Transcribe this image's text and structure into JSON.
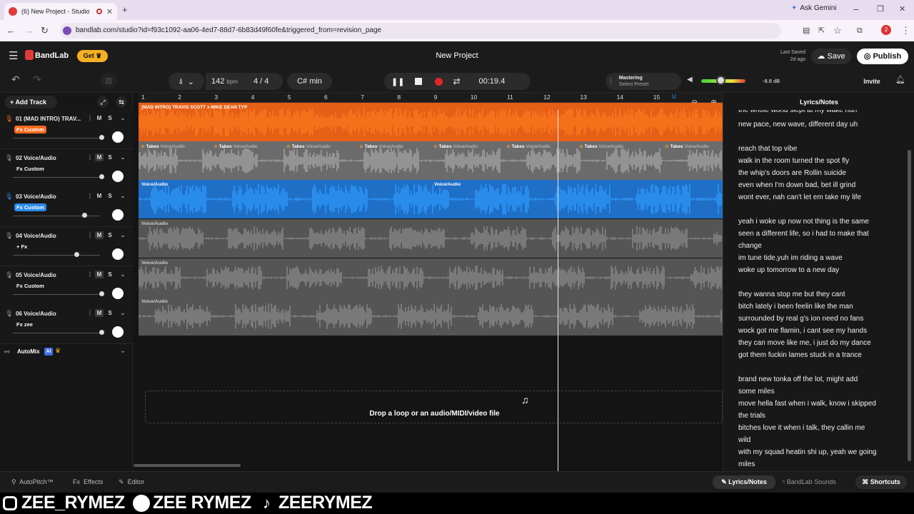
{
  "browser": {
    "tab_title": "(6) New Project - Studio",
    "url": "bandlab.com/studio?id=f93c1092-aa06-4ed7-88d7-6b83d49f60fe&triggered_from=revision_page",
    "ask_gemini": "Ask Gemini"
  },
  "app": {
    "brand": "BandLab",
    "get_label": "Get",
    "project_title": "New Project",
    "last_saved_label": "Last Saved",
    "last_saved_value": "2d ago",
    "save_label": "Save",
    "publish_label": "Publish",
    "invite_label": "Invite"
  },
  "transport": {
    "bpm": "142",
    "bpm_unit": "bpm",
    "time_sig": "4 / 4",
    "key": "C# min",
    "time": "00:19.4",
    "mastering_label": "Mastering",
    "mastering_sub": "Select Preset",
    "volume_db": "-8.8 dB"
  },
  "left": {
    "add_track_label": "Add Track",
    "tracks": [
      {
        "name": "01 (MAD INTRO) TRAV...",
        "fx": "Fx Custom",
        "accent": "#ff6a1a",
        "fx_style": "tag"
      },
      {
        "name": "02 Voice/Audio",
        "fx": "Fx Custom",
        "accent": "#9a9a9a",
        "fx_style": "plain"
      },
      {
        "name": "03 Voice/Audio",
        "fx": "Fx Custom",
        "accent": "#2a8be8",
        "fx_style": "tag"
      },
      {
        "name": "04 Voice/Audio",
        "fx": "+ Fx",
        "accent": "#9a9a9a",
        "fx_style": "plain"
      },
      {
        "name": "05 Voice/Audio",
        "fx": "Fx Custom",
        "accent": "#9a9a9a",
        "fx_style": "plain"
      },
      {
        "name": "06 Voice/Audio",
        "fx": "Fx zee",
        "accent": "#9a9a9a",
        "fx_style": "plain"
      }
    ],
    "m_label": "M",
    "s_label": "S",
    "automix_label": "AutoMix",
    "ai_label": "AI"
  },
  "ruler_ticks": [
    "1",
    "2",
    "3",
    "4",
    "5",
    "6",
    "7",
    "8",
    "9",
    "10",
    "11",
    "12",
    "13",
    "14",
    "15"
  ],
  "clips": {
    "track1_name": "(MAD INTRO) TRAVIS SCOTT x MIKE DEAN TYP",
    "takes_label": "Takes",
    "voice_label": "Voice/Audio"
  },
  "drop_text": "Drop a loop or an audio/MIDI/video file",
  "lyrics": {
    "title": "Lyrics/Notes",
    "lines": [
      "the whole world slept at my wake huh",
      "new pace, new wave, different day uh",
      "",
      "reach that top vibe",
      "walk in the room turned the spot fly",
      "the whip's doors are Rollin suicide",
      "even when I'm down bad, bet ill grind",
      "wont ever, nah can't let em take my life",
      "",
      "yeah i woke up now not thing is the same",
      "seen a different life, so i had to make that",
      "change",
      "im tune tide,yuh im riding a wave",
      "woke up tomorrow to a new day",
      "",
      "they wanna stop me but they cant",
      "bitch lately i been feelin like the man",
      "surrounded by real g's ion need no fans",
      "wock got me flamin, i cant see my hands",
      "they can move like me, i just do my dance",
      "got them fuckin lames stuck in a trance",
      "",
      "brand new tonka off the lot, might add",
      "some miles",
      "move hella fast when i walk, know i skipped",
      "the trials",
      "bitches love it when i talk, they callin me",
      "wild",
      "with my squad heatin shi up, yeah we going",
      "miles"
    ]
  },
  "bottom": {
    "autopitch": "AutoPitch™",
    "effects": "Effects",
    "editor": "Editor",
    "lyrics_notes": "Lyrics/Notes",
    "bandlab_sounds": "BandLab Sounds",
    "shortcuts": "Shortcuts"
  },
  "overlay": {
    "instagram": "ZEE_RYMEZ",
    "spotify": "ZEE RYMEZ",
    "tiktok": "ZEERYMEZ"
  }
}
